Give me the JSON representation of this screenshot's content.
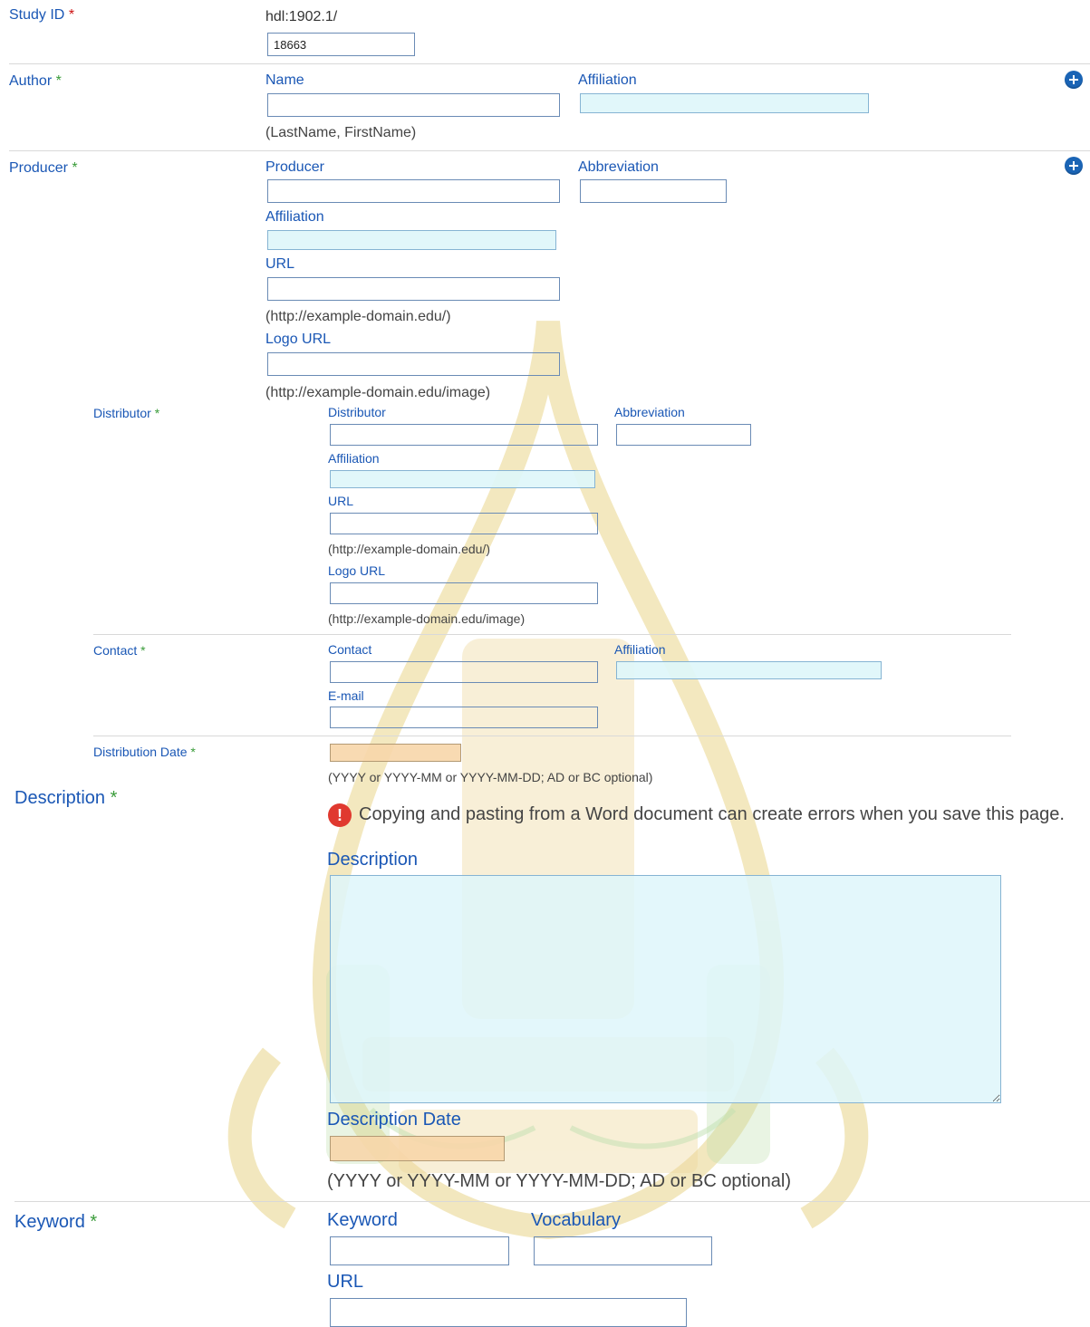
{
  "study_id": {
    "label": "Study ID",
    "required": "*",
    "prefix": "hdl:1902.1/",
    "value": "18663"
  },
  "author": {
    "label": "Author",
    "required": "*",
    "name_label": "Name",
    "affiliation_label": "Affiliation",
    "name_hint": "(LastName, FirstName)",
    "add_icon": "plus-circle-icon"
  },
  "producer": {
    "label": "Producer",
    "required": "*",
    "producer_label": "Producer",
    "abbreviation_label": "Abbreviation",
    "affiliation_label": "Affiliation",
    "url_label": "URL",
    "url_hint": "(http://example-domain.edu/)",
    "logo_url_label": "Logo URL",
    "logo_url_hint": "(http://example-domain.edu/image)",
    "add_icon": "plus-circle-icon"
  },
  "distributor": {
    "label": "Distributor",
    "required": "*",
    "distributor_label": "Distributor",
    "abbreviation_label": "Abbreviation",
    "affiliation_label": "Affiliation",
    "url_label": "URL",
    "url_hint": "(http://example-domain.edu/)",
    "logo_url_label": "Logo URL",
    "logo_url_hint": "(http://example-domain.edu/image)"
  },
  "contact": {
    "label": "Contact",
    "required": "*",
    "contact_label": "Contact",
    "affiliation_label": "Affiliation",
    "email_label": "E-mail"
  },
  "distribution_date": {
    "label": "Distribution Date",
    "required": "*",
    "hint": "(YYYY or YYYY-MM or YYYY-MM-DD; AD or BC optional)"
  },
  "description": {
    "label": "Description",
    "required": "*",
    "warning_icon": "exclamation-circle-icon",
    "warning": "Copying and pasting from a Word document can create errors when you save this page.",
    "description_label": "Description",
    "date_label": "Description Date",
    "date_hint": "(YYYY or YYYY-MM or YYYY-MM-DD; AD or BC optional)"
  },
  "keyword": {
    "label": "Keyword",
    "required": "*",
    "keyword_label": "Keyword",
    "vocabulary_label": "Vocabulary",
    "url_label": "URL"
  },
  "colors": {
    "label": "#1a57b5",
    "required_red": "#cc1111",
    "required_green": "#3a9c3a",
    "cyan_field": "#def6fa",
    "tan_field": "#f7d6aa",
    "plus_button": "#1a64b5"
  }
}
